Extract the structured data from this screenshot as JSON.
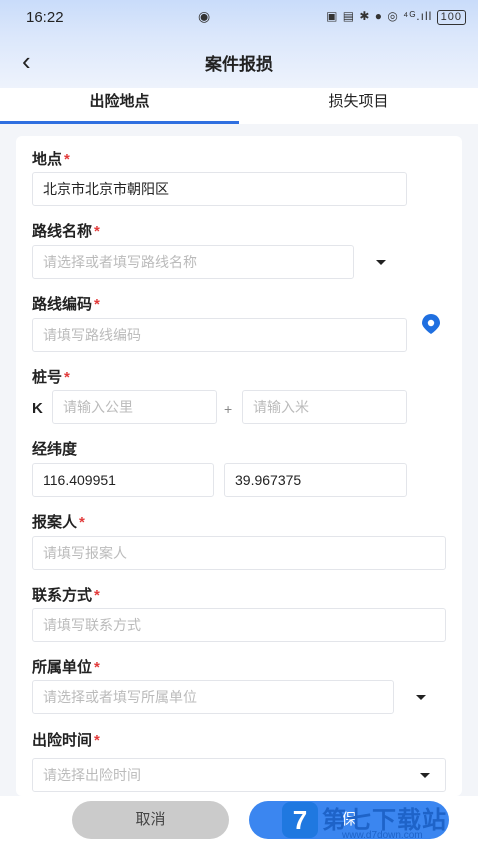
{
  "status_bar": {
    "time": "16:22",
    "icons_text": "▣ ▤ ✱ ● ◎ ⁴ᴳ.ıll",
    "battery": "100"
  },
  "nav": {
    "title": "案件报损"
  },
  "tabs": [
    {
      "label": "出险地点"
    },
    {
      "label": "损失项目"
    }
  ],
  "form": {
    "location": {
      "label": "地点",
      "value": "北京市北京市朝阳区"
    },
    "route_name": {
      "label": "路线名称",
      "placeholder": "请选择或者填写路线名称"
    },
    "route_code": {
      "label": "路线编码",
      "placeholder": "请填写路线编码"
    },
    "stake": {
      "label": "桩号",
      "prefix": "K",
      "km_placeholder": "请输入公里",
      "plus": "+",
      "m_placeholder": "请输入米"
    },
    "coords": {
      "label": "经纬度",
      "longitude": "116.409951",
      "latitude": "39.967375"
    },
    "reporter": {
      "label": "报案人",
      "placeholder": "请填写报案人"
    },
    "contact": {
      "label": "联系方式",
      "placeholder": "请填写联系方式"
    },
    "unit": {
      "label": "所属单位",
      "placeholder": "请选择或者填写所属单位"
    },
    "time": {
      "label": "出险时间",
      "placeholder": "请选择出险时间"
    },
    "required_mark": "*"
  },
  "footer": {
    "cancel": "取消",
    "save": "保"
  },
  "watermark": {
    "logo": "7",
    "text": "第七下载站",
    "url": "www.d7down.com"
  },
  "colors": {
    "accent": "#2f6fe0",
    "required": "#e23b3b"
  }
}
